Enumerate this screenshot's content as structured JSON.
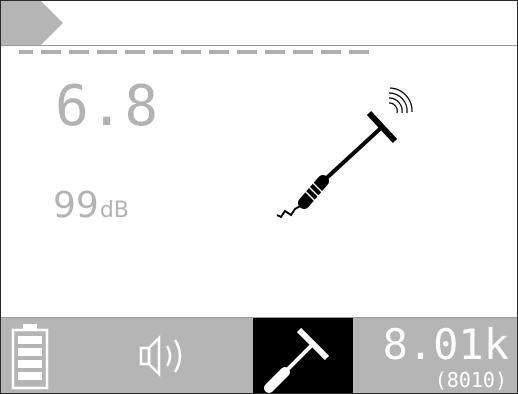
{
  "header": {
    "mode_tab_icon": "chevron-tab-icon"
  },
  "signal": {
    "indicator_icon": "signal-strength-dashes-icon"
  },
  "readings": {
    "depth": "6.8",
    "gain_value": "99",
    "gain_unit": "dB"
  },
  "graphic": {
    "probe_icon": "sonde-probe-icon"
  },
  "status_bar": {
    "battery_icon": "battery-icon",
    "volume_icon": "speaker-volume-icon",
    "tool_icon": "probe-tool-icon",
    "frequency": "8.01k",
    "frequency_hz": "(8010)"
  },
  "colors": {
    "text_dim": "#b3b3b3",
    "status_bg": "#b5b5b5",
    "active_slot_bg": "#000000",
    "text_light": "#ffffff"
  }
}
